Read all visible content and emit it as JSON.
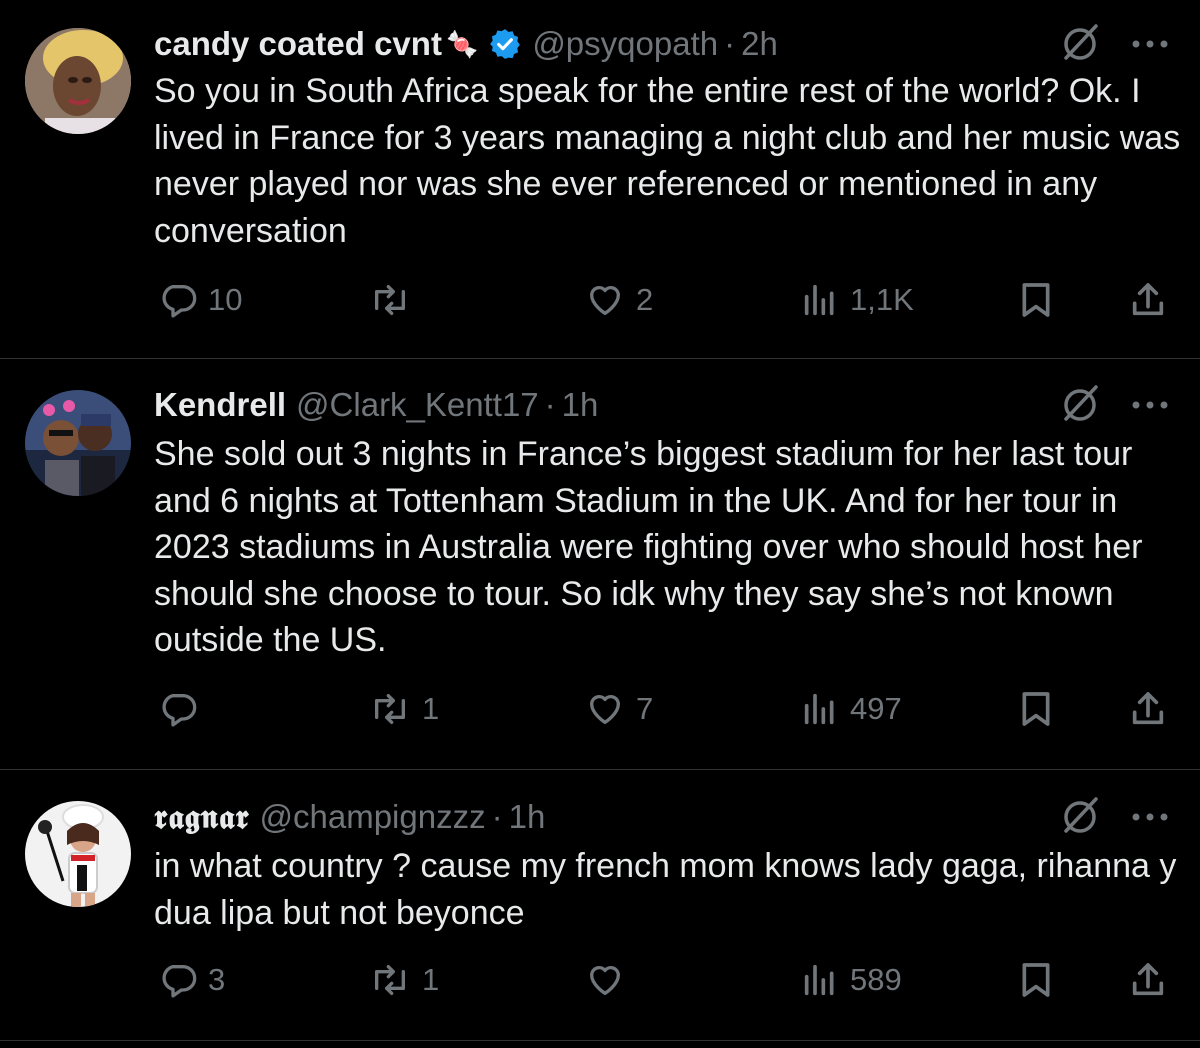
{
  "tweets": [
    {
      "display_name": "candy coated cvnt",
      "name_emoji": "🍬",
      "verified": true,
      "handle": "@psyqopath",
      "separator": "·",
      "time": "2h",
      "text": "So you in South Africa speak for the entire rest of the world? Ok. I lived in France for 3 years managing a night club and her music was never played nor was she ever referenced or mentioned in any conversation",
      "stats": {
        "replies": "10",
        "reposts": "",
        "likes": "2",
        "views": "1,1K"
      }
    },
    {
      "display_name": "Kendrell",
      "verified": false,
      "handle": "@Clark_Kentt17",
      "separator": "·",
      "time": "1h",
      "text": "She sold out 3 nights in France’s biggest stadium for her last tour and 6 nights at Tottenham Stadium in the UK. And for her tour in 2023 stadiums in Australia were fighting over who should host her should she choose to tour. So idk why they say she’s not known outside the US.",
      "stats": {
        "replies": "",
        "reposts": "1",
        "likes": "7",
        "views": "497"
      }
    },
    {
      "display_name": "𝖗𝖆𝖌𝖓𝖆𝖗",
      "verified": false,
      "handle": "@champignzzz",
      "separator": "·",
      "time": "1h",
      "text": "in what country ? cause my french mom knows lady gaga, rihanna y dua lipa but not beyonce",
      "stats": {
        "replies": "3",
        "reposts": "1",
        "likes": "",
        "views": "589"
      }
    }
  ],
  "icons": {
    "reply": "reply-icon",
    "repost": "repost-icon",
    "like": "like-icon",
    "views": "views-icon",
    "bookmark": "bookmark-icon",
    "share": "share-icon",
    "grok": "grok-icon",
    "more": "more-icon",
    "verified": "verified-badge-icon"
  },
  "colors": {
    "background": "#000000",
    "text": "#e7e9ea",
    "secondary": "#71767b",
    "verified": "#1d9bf0",
    "divider": "#2f3336"
  }
}
